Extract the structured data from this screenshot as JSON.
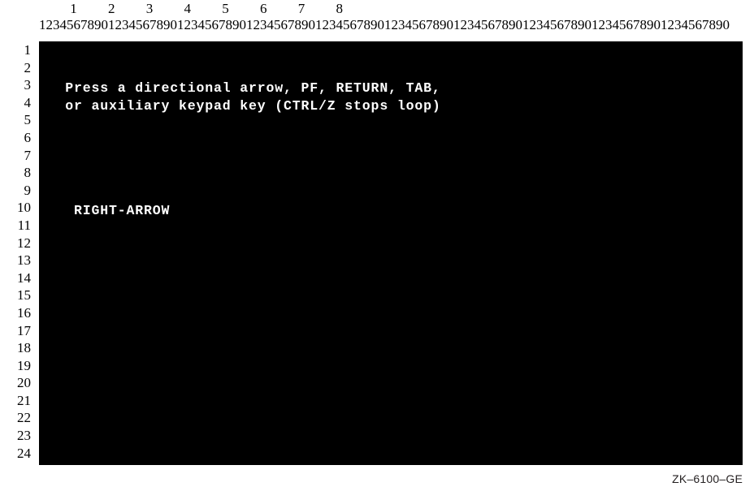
{
  "figure": {
    "caption": "ZK–6100–GE",
    "screen_background": "#000000",
    "screen_foreground": "#ffffff",
    "page_background": "#ffffff"
  },
  "ruler": {
    "tens_row": "         1         2         3         4         5         6         7         8",
    "ones_row": "1234567890123456789012345678901234567890123456789012345678901234567890123456789012345678901234567890",
    "columns": 80,
    "tens_labels": [
      "1",
      "2",
      "3",
      "4",
      "5",
      "6",
      "7",
      "8"
    ]
  },
  "gutter": {
    "line_numbers": [
      "1",
      "2",
      "3",
      "4",
      "5",
      "6",
      "7",
      "8",
      "9",
      "10",
      "11",
      "12",
      "13",
      "14",
      "15",
      "16",
      "17",
      "18",
      "19",
      "20",
      "21",
      "22",
      "23",
      "24"
    ]
  },
  "terminal": {
    "rows": 24,
    "columns": 80,
    "lines": [
      "",
      "",
      "   Press a directional arrow, PF, RETURN, TAB,",
      "   or auxiliary keypad key (CTRL/Z stops loop)",
      "",
      "",
      "",
      "",
      "",
      "    RIGHT-ARROW",
      "",
      "",
      "",
      "",
      "",
      "",
      "",
      "",
      "",
      "",
      "",
      "",
      "",
      ""
    ],
    "prompt_text_line_1": "Press a directional arrow, PF, RETURN, TAB,",
    "prompt_text_line_2": "or auxiliary keypad key (CTRL/Z stops loop)",
    "response_text": "RIGHT-ARROW"
  }
}
